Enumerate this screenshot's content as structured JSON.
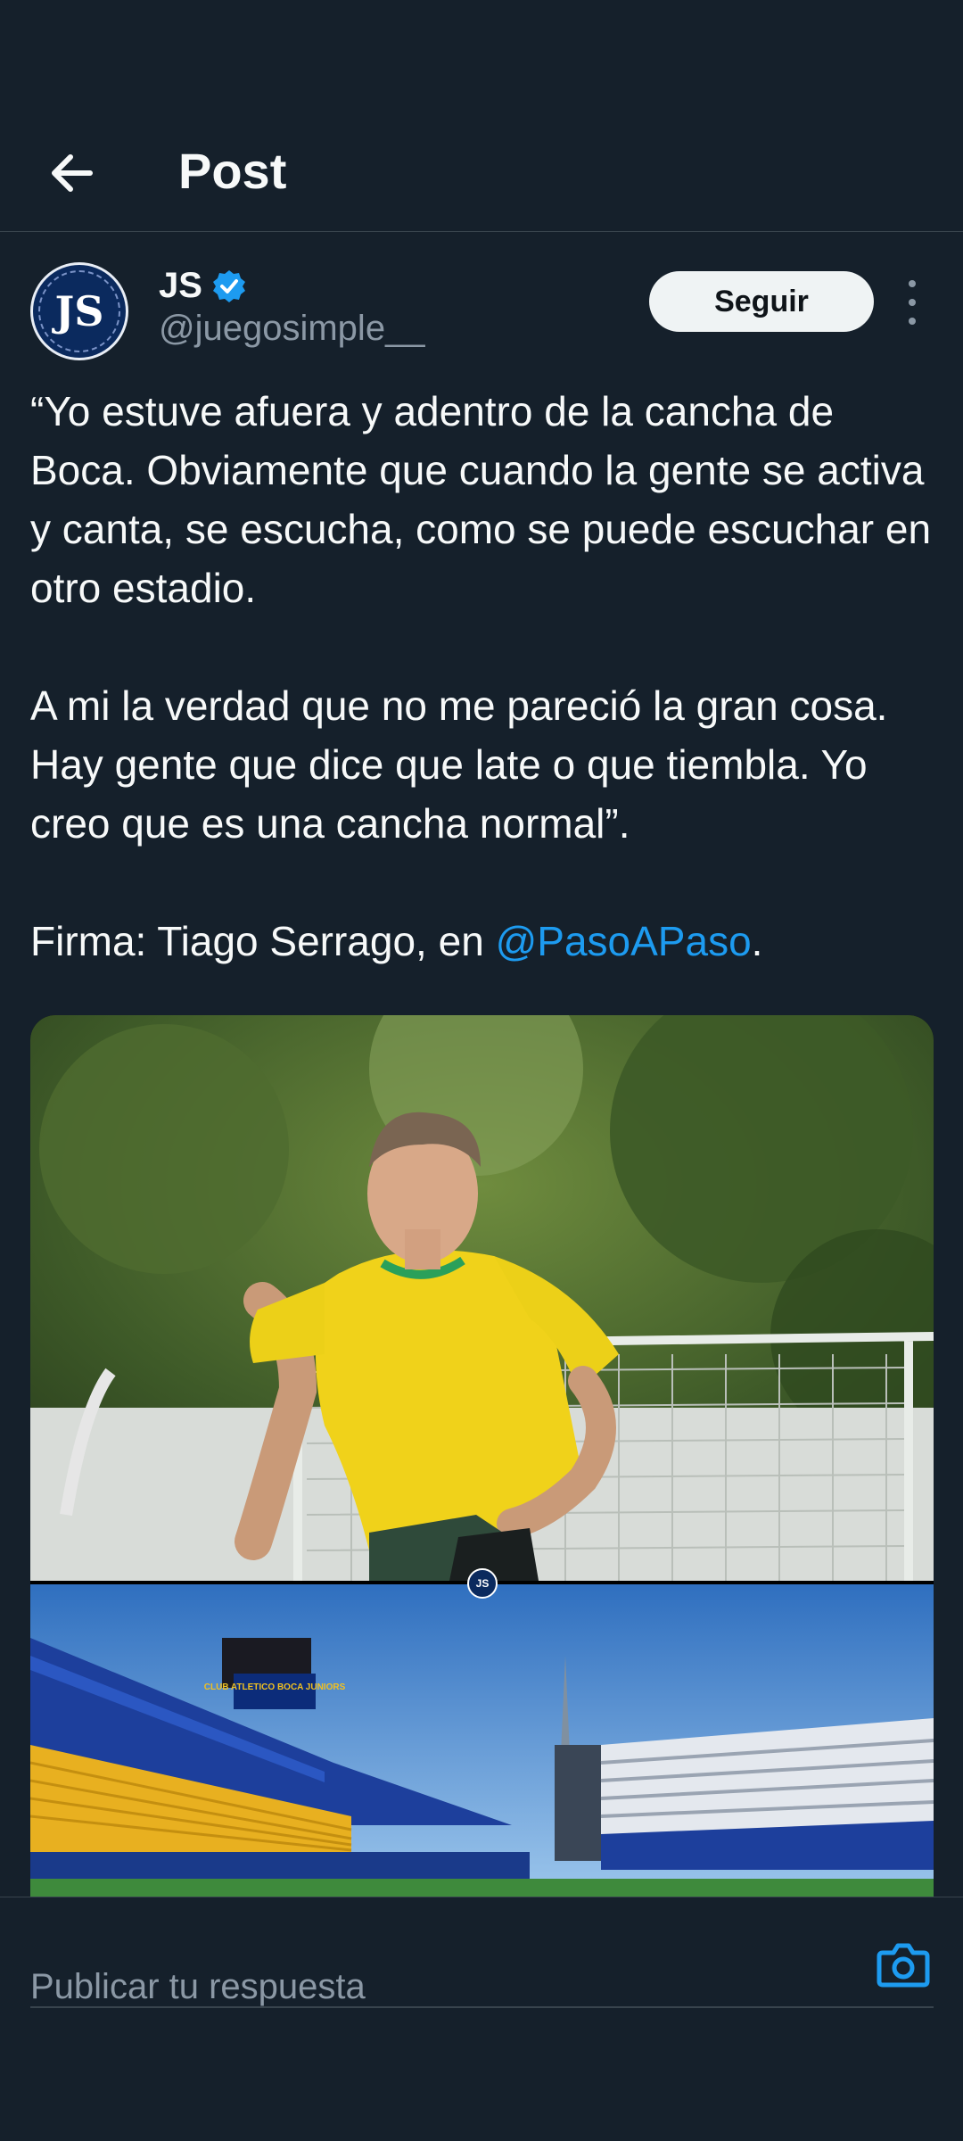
{
  "header": {
    "title": "Post"
  },
  "author": {
    "avatar_text": "JS",
    "display_name": "JS",
    "handle": "@juegosimple__",
    "verified": true,
    "follow_label": "Seguir"
  },
  "tweet": {
    "para1": "“Yo estuve afuera y adentro de la cancha de Boca. Obviamente que cuando la gente se activa y canta, se escucha, como se puede escuchar en otro estadio.",
    "para2": "A mi la verdad que no me pareció la gran cosa. Hay gente que dice que late o que tiembla. Yo creo que es una cancha normal”.",
    "para3_prefix": "Firma: Tiago Serrago, en ",
    "para3_mention": "@PasoAPaso",
    "para3_suffix": "."
  },
  "media": {
    "top_description": "photo-player-yellow-jersey",
    "bottom_description": "photo-stadium",
    "stadium_sign": "CLUB ATLETICO BOCA JUNIORS",
    "watermark_text": "JS"
  },
  "reply": {
    "placeholder": "Publicar tu respuesta"
  },
  "colors": {
    "background": "#15202b",
    "accent": "#1d9bf0",
    "muted": "#8b98a5",
    "border": "#38444d"
  },
  "icons": {
    "back": "back-arrow-icon",
    "verified": "verified-badge-icon",
    "more": "more-vertical-icon",
    "camera": "camera-icon"
  }
}
